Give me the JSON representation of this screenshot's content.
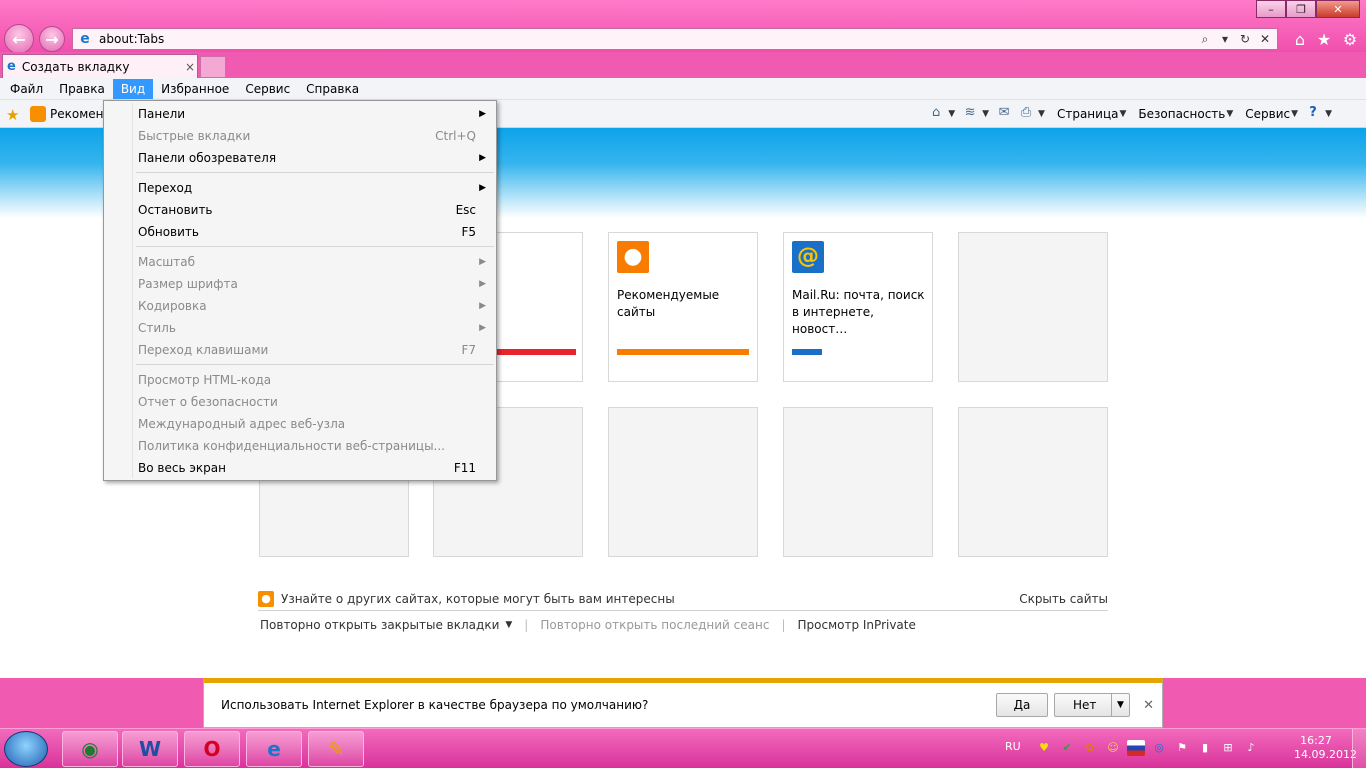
{
  "window": {
    "minimize_glyph": "–",
    "maximize_glyph": "❐",
    "close_glyph": "✕"
  },
  "address": {
    "url": "about:Tabs"
  },
  "tab": {
    "title": "Создать вкладку",
    "close_glyph": "×"
  },
  "menubar": {
    "items": [
      "Файл",
      "Правка",
      "Вид",
      "Избранное",
      "Сервис",
      "Справка"
    ]
  },
  "favorites": {
    "label": "Рекоменд"
  },
  "commands": {
    "page": "Страница",
    "safety": "Безопасность",
    "tools": "Сервис"
  },
  "view_menu": {
    "items": [
      {
        "label": "Панели",
        "shortcut": "",
        "submenu": true,
        "disabled": false
      },
      {
        "label": "Быстрые вкладки",
        "shortcut": "Ctrl+Q",
        "submenu": false,
        "disabled": true
      },
      {
        "label": "Панели обозревателя",
        "shortcut": "",
        "submenu": true,
        "disabled": false
      },
      {
        "label": "Переход",
        "shortcut": "",
        "submenu": true,
        "disabled": false
      },
      {
        "label": "Остановить",
        "shortcut": "Esc",
        "submenu": false,
        "disabled": false
      },
      {
        "label": "Обновить",
        "shortcut": "F5",
        "submenu": false,
        "disabled": false
      },
      {
        "label": "Масштаб",
        "shortcut": "",
        "submenu": true,
        "disabled": true
      },
      {
        "label": "Размер шрифта",
        "shortcut": "",
        "submenu": true,
        "disabled": true
      },
      {
        "label": "Кодировка",
        "shortcut": "",
        "submenu": true,
        "disabled": true
      },
      {
        "label": "Стиль",
        "shortcut": "",
        "submenu": true,
        "disabled": true
      },
      {
        "label": "Переход клавишами",
        "shortcut": "F7",
        "submenu": false,
        "disabled": true
      },
      {
        "label": "Просмотр HTML-кода",
        "shortcut": "",
        "submenu": false,
        "disabled": true
      },
      {
        "label": "Отчет о безопасности",
        "shortcut": "",
        "submenu": false,
        "disabled": true
      },
      {
        "label": "Международный адрес веб-узла",
        "shortcut": "",
        "submenu": false,
        "disabled": true
      },
      {
        "label": "Политика конфиденциальности веб-страницы...",
        "shortcut": "",
        "submenu": false,
        "disabled": true
      },
      {
        "label": "Во весь экран",
        "shortcut": "F11",
        "submenu": false,
        "disabled": false
      }
    ]
  },
  "tiles": {
    "recommended": {
      "title": "Рекомендуемые сайты",
      "icon": "lightbulb-icon",
      "color": "#f77c00"
    },
    "mailru": {
      "title": "Mail.Ru: почта, поиск в интернете, новост…",
      "icon": "at-sign-icon",
      "color": "#1a6fc8"
    },
    "red_bar_color": "#e8232b"
  },
  "page": {
    "discover_text": "Узнайте о других сайтах, которые могут быть вам интересны",
    "hide_sites": "Скрыть сайты",
    "reopen_tabs": "Повторно открыть закрытые вкладки",
    "reopen_session": "Повторно открыть последний сеанс",
    "inprivate": "Просмотр InPrivate"
  },
  "notification": {
    "message": "Использовать Internet Explorer в качестве браузера по умолчанию?",
    "yes": "Да",
    "no": "Нет",
    "close": "✕"
  },
  "taskbar": {
    "lang": "RU",
    "time": "16:27",
    "date": "14.09.2012"
  }
}
